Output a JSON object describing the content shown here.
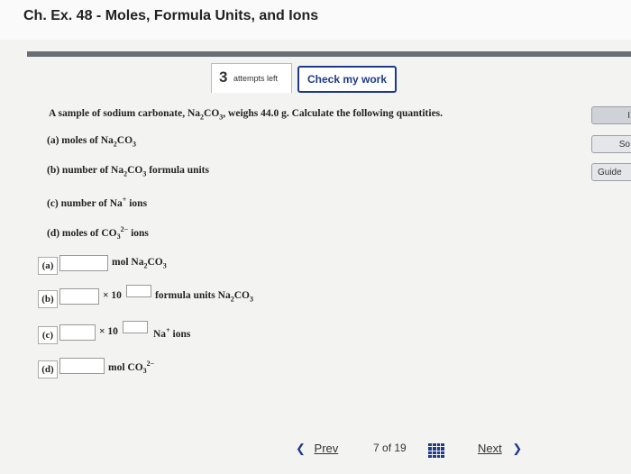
{
  "header": {
    "title": "Ch. Ex. 48 - Moles, Formula Units, and Ions"
  },
  "toolbar": {
    "attempts_num": "3",
    "attempts_label": "attempts left",
    "check_label": "Check my work"
  },
  "problem": {
    "text_start": "A sample of sodium carbonate, Na",
    "text_mid1": "CO",
    "text_mid2": ", weighs 44.0 g. Calculate the following quantities."
  },
  "questions": {
    "a": {
      "prefix": "(a) moles of Na",
      "mid": "CO"
    },
    "b": {
      "prefix": "(b) number of Na",
      "mid": "CO",
      "suffix": " formula units"
    },
    "c": {
      "prefix": "(c) number of Na",
      "sup": "+",
      "suffix": " ions"
    },
    "d": {
      "prefix": "(d) moles of CO",
      "suffix": " ions"
    }
  },
  "answers": {
    "a": {
      "label": "(a)",
      "unit_prefix": "mol Na",
      "unit_mid": "CO"
    },
    "b": {
      "label": "(b)",
      "times": "× 10",
      "unit_prefix": "formula units Na",
      "unit_mid": "CO"
    },
    "c": {
      "label": "(c)",
      "times": "× 10",
      "unit_prefix": "Na",
      "unit_sup": "+",
      "unit_suffix": " ions"
    },
    "d": {
      "label": "(d)",
      "unit_prefix": "mol CO"
    }
  },
  "side": {
    "btn1": "I",
    "btn2": "So",
    "btn3": "Guide"
  },
  "nav": {
    "prev": "Prev",
    "page_current": "7",
    "page_of": "of 19",
    "next": "Next"
  },
  "subs": {
    "two": "2",
    "three": "3",
    "charge": "2−"
  }
}
